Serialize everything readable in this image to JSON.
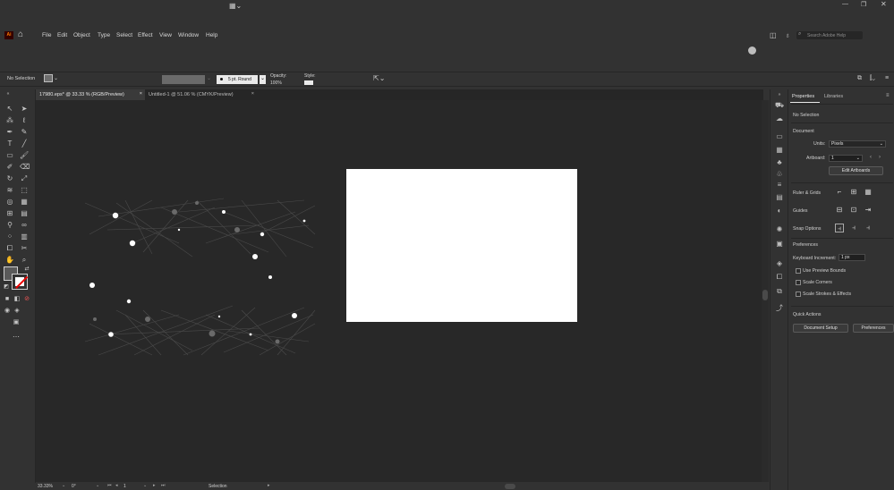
{
  "menubar": {
    "items": [
      "File",
      "Edit",
      "Object",
      "Type",
      "Select",
      "Effect",
      "View",
      "Window",
      "Help"
    ],
    "search_placeholder": "Search Adobe Help",
    "app_icon_label": "Ai"
  },
  "controlbar": {
    "selection_label": "No Selection",
    "stroke_style": "5 pt. Round",
    "opacity_label": "Opacity:",
    "opacity_value": "100%",
    "style_label": "Style:"
  },
  "tabs": [
    {
      "label": "17980.eps* @ 33.33 % (RGB/Preview)"
    },
    {
      "label": "Untitled-1 @ 51.06 % (CMYK/Preview)"
    }
  ],
  "statusbar": {
    "zoom": "33.33%",
    "rotation": "0°",
    "artboard_num": "1",
    "tool": "Selection"
  },
  "panel": {
    "tab_properties": "Properties",
    "tab_libraries": "Libraries",
    "no_selection": "No Selection",
    "document_heading": "Document",
    "units_label": "Units:",
    "units_value": "Pixels",
    "artboard_label": "Artboard:",
    "artboard_value": "1",
    "edit_artboards": "Edit Artboards",
    "ruler_grids": "Ruler & Grids",
    "guides": "Guides",
    "snap_options": "Snap Options",
    "preferences_heading": "Preferences",
    "keyboard_increment_label": "Keyboard Increment:",
    "keyboard_increment_value": "1 px",
    "use_preview_bounds": "Use Preview Bounds",
    "scale_corners": "Scale Corners",
    "scale_strokes": "Scale Strokes & Effects",
    "quick_actions": "Quick Actions",
    "document_setup": "Document Setup",
    "preferences_btn": "Preferences"
  },
  "colors": {
    "bg": "#323232",
    "canvas": "#282828",
    "artboard": "#ffffff",
    "ai_logo": "#ff7c00"
  }
}
